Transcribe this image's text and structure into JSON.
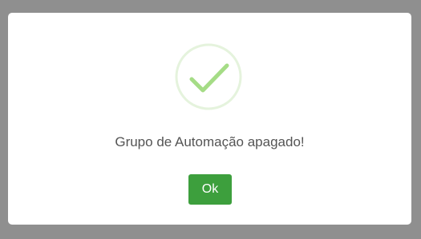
{
  "dialog": {
    "icon": "success-check-icon",
    "message": "Grupo de Automação apagado!",
    "confirm_label": "Ok"
  },
  "colors": {
    "backdrop": "#8f8f8f",
    "icon_ring": "#e5f3dd",
    "icon_check": "#a5dc86",
    "button": "#3d9f3d",
    "button_text": "#ffffff",
    "message_text": "#545454"
  }
}
